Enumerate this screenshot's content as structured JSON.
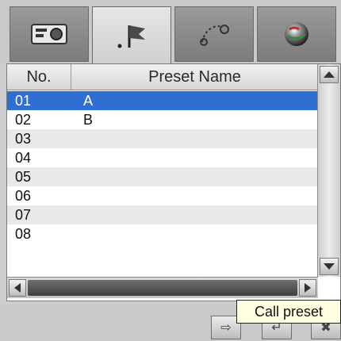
{
  "tabs": [
    {
      "icon": "camera-settings-icon"
    },
    {
      "icon": "preset-flag-icon"
    },
    {
      "icon": "pattern-path-icon"
    },
    {
      "icon": "color-ball-icon"
    }
  ],
  "table": {
    "columns": {
      "no": "No.",
      "name": "Preset Name"
    },
    "rows": [
      {
        "no": "01",
        "name": "A",
        "selected": true
      },
      {
        "no": "02",
        "name": "B"
      },
      {
        "no": "03",
        "name": ""
      },
      {
        "no": "04",
        "name": ""
      },
      {
        "no": "05",
        "name": ""
      },
      {
        "no": "06",
        "name": ""
      },
      {
        "no": "07",
        "name": ""
      },
      {
        "no": "08",
        "name": ""
      }
    ]
  },
  "tooltip": {
    "text": "Call preset"
  },
  "colors": {
    "selection": "#2f6fd3",
    "tooltip_bg": "#ffffe1"
  }
}
